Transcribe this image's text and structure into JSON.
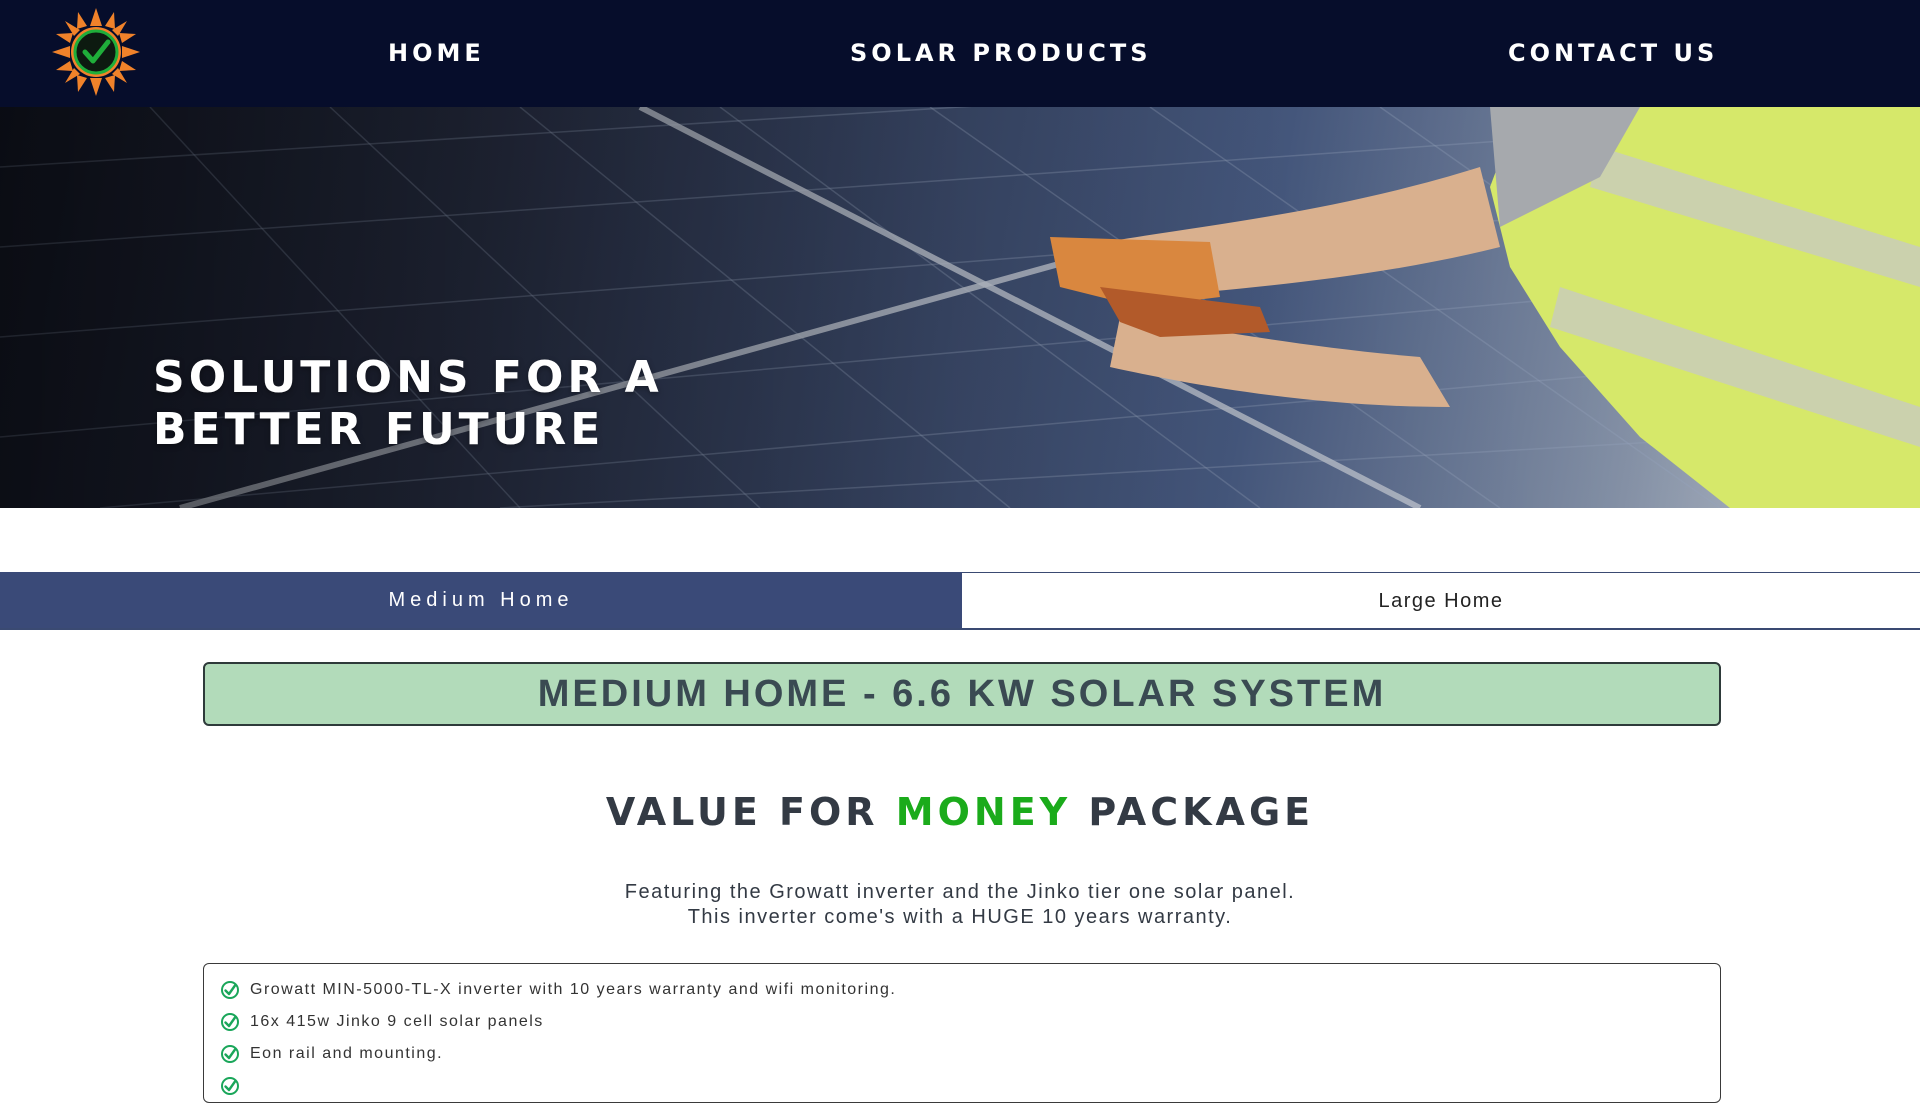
{
  "nav": {
    "logo_icon": "sun-check-logo",
    "links": [
      "HOME",
      "SOLAR PRODUCTS",
      "CONTACT US"
    ]
  },
  "hero": {
    "title_line1": "SOLUTIONS FOR A",
    "title_line2": "BETTER FUTURE"
  },
  "tabs": {
    "active": "Medium Home",
    "inactive": "Large Home"
  },
  "package": {
    "banner": "MEDIUM HOME - 6.6 KW SOLAR SYSTEM",
    "heading_pre": "VALUE FOR ",
    "heading_accent": "MONEY",
    "heading_post": " PACKAGE",
    "description_line1": "Featuring the Growatt inverter and the Jinko tier one solar panel.",
    "description_line2": "This inverter come's with a HUGE 10 years warranty.",
    "features": [
      "Growatt MIN-5000-TL-X inverter with 10 years warranty and wifi monitoring.",
      "16x 415w Jinko 9 cell solar panels",
      "Eon rail and mounting.",
      ""
    ]
  },
  "colors": {
    "nav_bg": "#060d2b",
    "tab_active": "#3a4a78",
    "banner_bg": "#b2dbba",
    "accent_green": "#1bab1b",
    "logo_orange": "#f0822a"
  }
}
